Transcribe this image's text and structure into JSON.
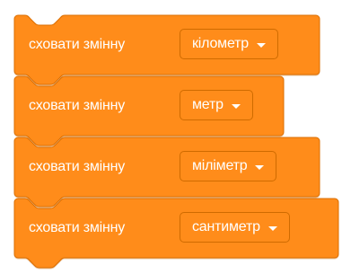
{
  "colors": {
    "block_fill": "#ff8c1a",
    "block_stroke": "#db6e00",
    "text": "#ffffff"
  },
  "blocks": [
    {
      "label": "сховати змінну",
      "variable": "кілометр"
    },
    {
      "label": "сховати змінну",
      "variable": "метр"
    },
    {
      "label": "сховати змінну",
      "variable": "міліметр"
    },
    {
      "label": "сховати змінну",
      "variable": "сантиметр"
    }
  ]
}
